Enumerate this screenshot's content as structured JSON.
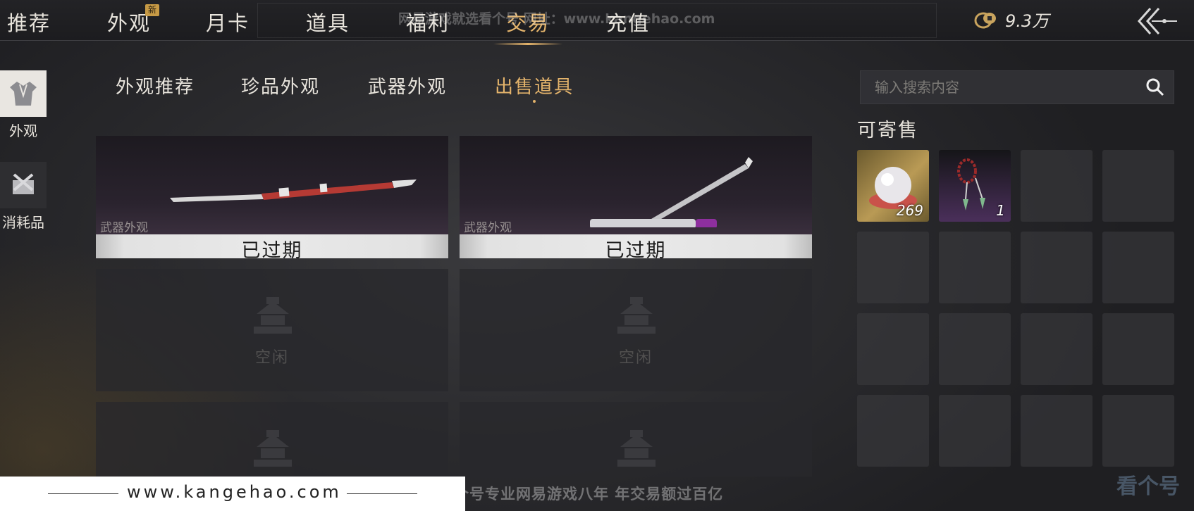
{
  "nav": {
    "tabs": [
      {
        "label": "推荐"
      },
      {
        "label": "外观",
        "badge": "新"
      },
      {
        "label": "月卡"
      },
      {
        "label": "道具"
      },
      {
        "label": "福利"
      },
      {
        "label": "交易",
        "active": true
      },
      {
        "label": "充值"
      }
    ],
    "watermark": "网易游戏就选看个号  网址：www.kangehao.com",
    "currency": {
      "icon": "coin-icon",
      "value": "9.3万"
    },
    "back_icon": "back-arrow-icon"
  },
  "sidebar": {
    "items": [
      {
        "label": "外观",
        "icon": "robe-icon",
        "active": true
      },
      {
        "label": "消耗品",
        "icon": "package-icon"
      }
    ]
  },
  "subtabs": [
    {
      "label": "外观推荐"
    },
    {
      "label": "珍品外观"
    },
    {
      "label": "武器外观"
    },
    {
      "label": "出售道具",
      "active": true
    }
  ],
  "listings": {
    "cards": [
      {
        "status": "已过期",
        "category": "武器外观",
        "icon": "sword-icon"
      },
      {
        "status": "已过期",
        "category": "武器外观",
        "icon": "sword-icon"
      },
      {
        "status": "空闲",
        "icon": "pavilion-icon"
      },
      {
        "status": "空闲",
        "icon": "pavilion-icon"
      },
      {
        "status": "",
        "icon": "pavilion-icon"
      },
      {
        "status": "",
        "icon": "pavilion-icon"
      }
    ]
  },
  "inventory": {
    "search_placeholder": "输入搜索内容",
    "title": "可寄售",
    "items": [
      {
        "icon": "pearl-icon",
        "count": "269"
      },
      {
        "icon": "bead-pendant-icon",
        "count": "1"
      }
    ]
  },
  "footer": {
    "url": "www.kangehao.com",
    "slogan": "看个号专业网易游戏八年  年交易额过百亿",
    "logo": "看个号"
  },
  "colors": {
    "accent": "#e3b36b",
    "background": "#2a2a2d",
    "expired_bar": "#e6e6e6"
  }
}
